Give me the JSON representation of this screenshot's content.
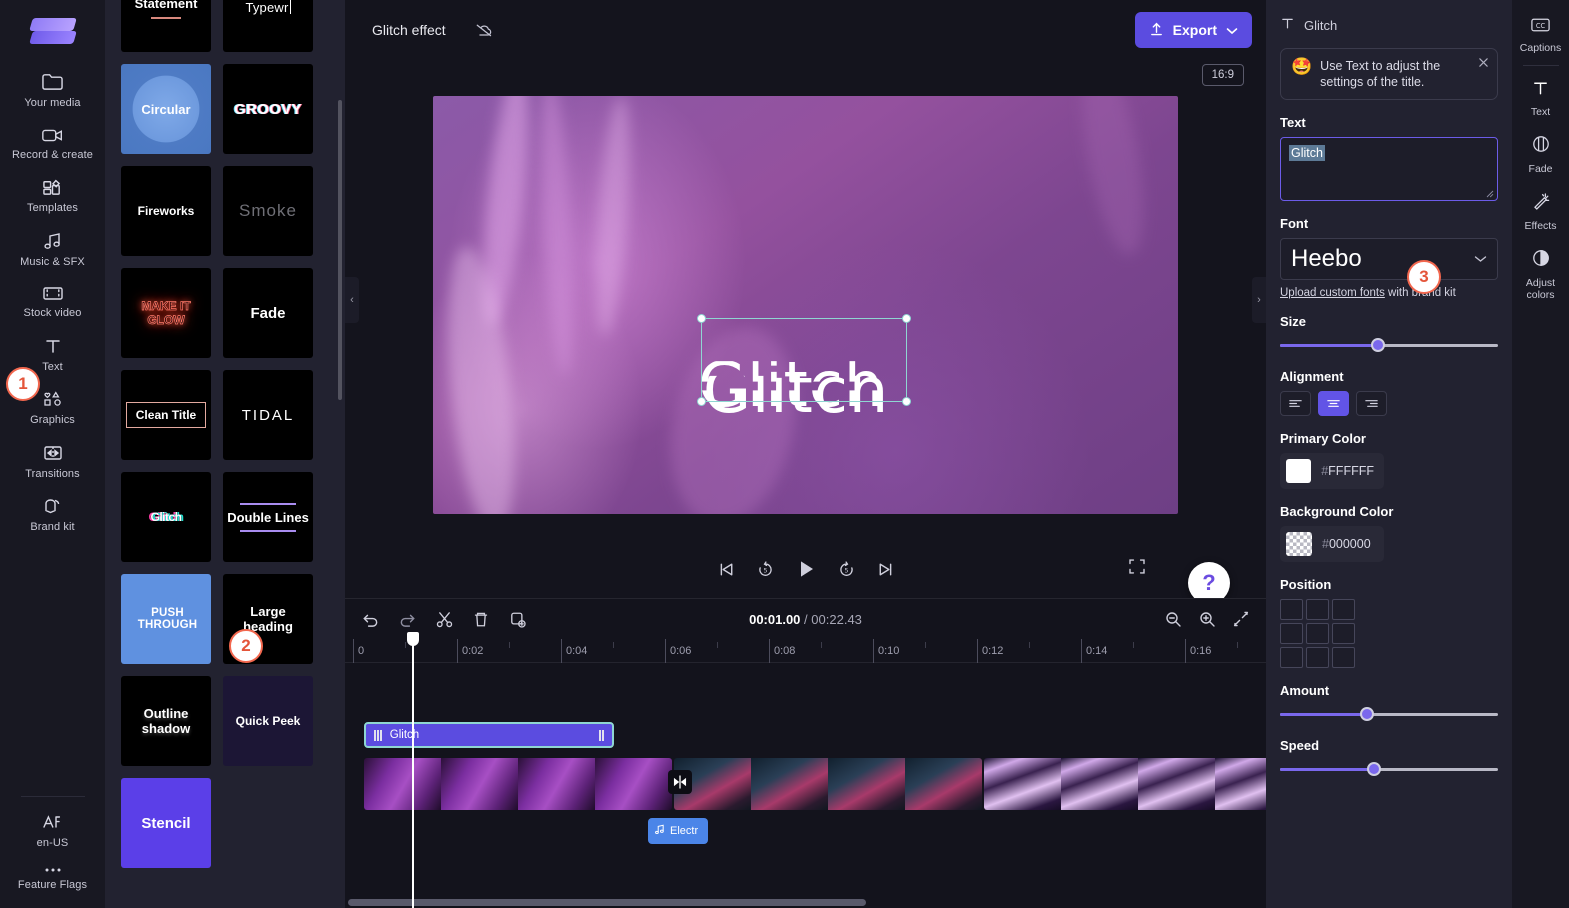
{
  "sidebar": {
    "logo_name": "clipchamp-logo",
    "items": [
      {
        "label": "Your media",
        "icon": "folder-icon"
      },
      {
        "label": "Record & create",
        "icon": "video-camera-icon"
      },
      {
        "label": "Templates",
        "icon": "templates-icon"
      },
      {
        "label": "Music & SFX",
        "icon": "music-note-icon"
      },
      {
        "label": "Stock video",
        "icon": "film-strip-icon"
      },
      {
        "label": "Text",
        "icon": "text-t-icon"
      },
      {
        "label": "Graphics",
        "icon": "graphics-shapes-icon"
      },
      {
        "label": "Transitions",
        "icon": "transitions-icon"
      },
      {
        "label": "Brand kit",
        "icon": "brand-kit-icon"
      }
    ],
    "bottom_items": [
      {
        "label": "en-US",
        "icon": "language-icon"
      },
      {
        "label": "Feature Flags",
        "icon": "ellipsis-icon"
      }
    ]
  },
  "templates": {
    "items": [
      {
        "label": "Statement",
        "style": "statement"
      },
      {
        "label": "Typewr",
        "style": "typewr"
      },
      {
        "label": "Circular",
        "style": "circular"
      },
      {
        "label": "GROOVY",
        "style": "groovy"
      },
      {
        "label": "Fireworks",
        "style": "fireworks"
      },
      {
        "label": "Smoke",
        "style": "smoke"
      },
      {
        "label": "MAKE IT GLOW",
        "style": "glow"
      },
      {
        "label": "Fade",
        "style": "fade"
      },
      {
        "label": "Clean Title",
        "style": "clean"
      },
      {
        "label": "TIDAL",
        "style": "tidal"
      },
      {
        "label": "Glitch",
        "style": "glitchtpl"
      },
      {
        "label": "Double Lines",
        "style": "dbl"
      },
      {
        "label": "PUSH THROUGH",
        "style": "push"
      },
      {
        "label": "Large heading",
        "style": "large"
      },
      {
        "label": "Outline shadow",
        "style": "outline"
      },
      {
        "label": "Quick Peek",
        "style": "quick"
      },
      {
        "label": "Stencil",
        "style": "stencil"
      }
    ]
  },
  "topbar": {
    "project_name": "Glitch effect",
    "cloud_icon": "cloud-off-icon",
    "export_label": "Export",
    "export_icon": "upload-icon",
    "export_caret": "chevron-down-icon"
  },
  "preview": {
    "aspect_ratio": "16:9",
    "canvas_text": "Glitch",
    "canvas_ghost_text": "Glitch",
    "help_glyph": "?",
    "collapse_left": "‹",
    "collapse_right": "›",
    "chevron_down": "⌄",
    "controls": [
      {
        "name": "skip-to-start-button"
      },
      {
        "name": "rewind-5-seconds-button"
      },
      {
        "name": "play-button"
      },
      {
        "name": "forward-5-seconds-button"
      },
      {
        "name": "skip-to-end-button"
      },
      {
        "name": "fullscreen-button"
      }
    ]
  },
  "timeline": {
    "tools": [
      {
        "name": "undo-button",
        "icon": "undo-icon"
      },
      {
        "name": "redo-button",
        "icon": "redo-icon"
      },
      {
        "name": "split-button",
        "icon": "scissors-icon"
      },
      {
        "name": "delete-button",
        "icon": "trash-icon"
      },
      {
        "name": "duplicate-button",
        "icon": "duplicate-icon"
      }
    ],
    "current_time": "00:01.00",
    "separator": "/",
    "total_time": "00:22.43",
    "zoom_out_icon": "zoom-out-icon",
    "zoom_in_icon": "zoom-in-icon",
    "fit_icon": "fit-to-screen-icon",
    "ruler_ticks": [
      "0",
      "0:02",
      "0:04",
      "0:06",
      "0:08",
      "0:10",
      "0:12",
      "0:14",
      "0:16"
    ],
    "text_clip_label": "Glitch",
    "audio_clip_label": "Electr",
    "audio_clip_icon": "music-note-icon",
    "split_marker_icon": "split-clip-icon"
  },
  "properties": {
    "header_title": "Glitch",
    "header_icon": "text-t-icon",
    "tip": {
      "emoji": "🤩",
      "message": "Use Text to adjust the settings of the title.",
      "close_icon": "close-icon"
    },
    "text_label": "Text",
    "text_value": "Glitch",
    "font_label": "Font",
    "font_value": "Heebo",
    "font_caret": "chevron-down-icon",
    "upload_link": "Upload custom fonts",
    "upload_suffix": " with brand kit",
    "size_label": "Size",
    "size_percent": 45,
    "alignment_label": "Alignment",
    "alignment_options": [
      "align-left",
      "align-center",
      "align-right"
    ],
    "alignment_selected": "align-center",
    "primary_color_label": "Primary Color",
    "primary_color_hash": "#",
    "primary_color_value": "FFFFFF",
    "primary_color_hex": "#FFFFFF",
    "background_color_label": "Background Color",
    "background_color_hash": "#",
    "background_color_value": "000000",
    "background_color_hex": "#000000",
    "position_label": "Position",
    "amount_label": "Amount",
    "amount_percent": 40,
    "speed_label": "Speed",
    "speed_percent": 43
  },
  "right_rail": {
    "items": [
      {
        "label": "Captions",
        "icon": "closed-captions-icon"
      },
      {
        "label": "Text",
        "icon": "text-t-icon"
      },
      {
        "label": "Fade",
        "icon": "fade-icon"
      },
      {
        "label": "Effects",
        "icon": "magic-wand-icon"
      },
      {
        "label": "Adjust colors",
        "icon": "contrast-circle-icon"
      }
    ]
  },
  "steps": {
    "one": "1",
    "two": "2",
    "three": "3"
  }
}
